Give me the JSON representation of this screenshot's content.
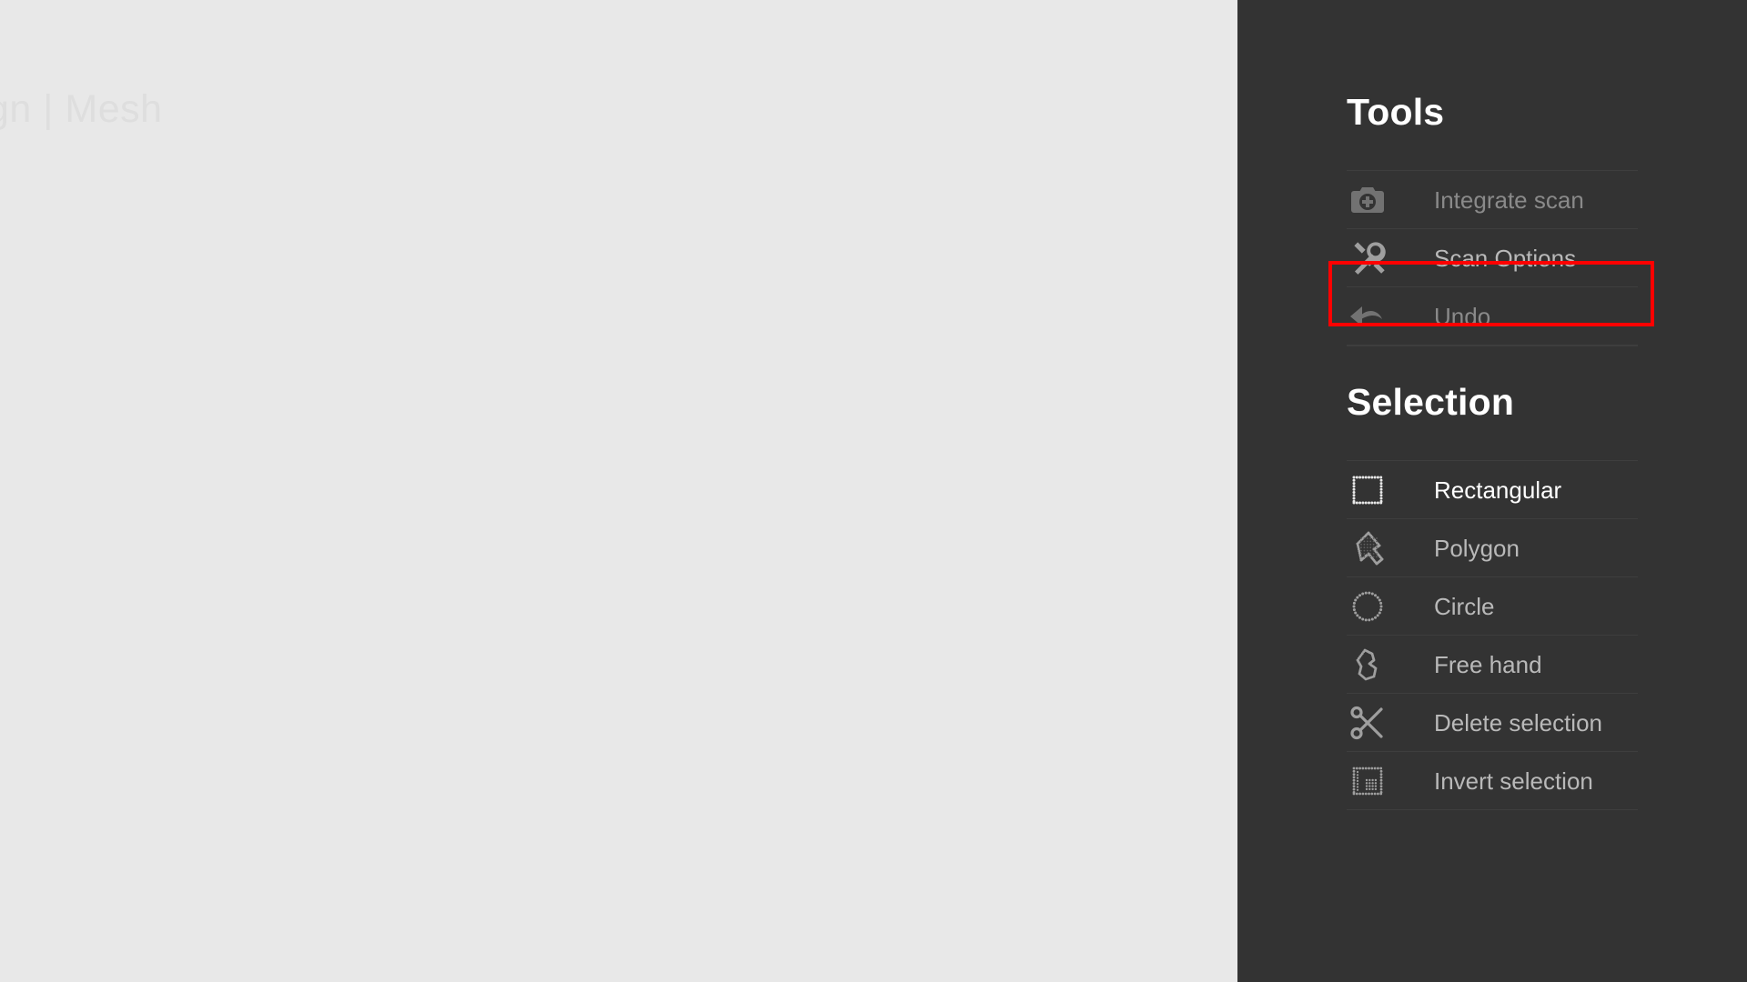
{
  "canvas": {
    "title_fragment": "gn | Mesh"
  },
  "sidebar": {
    "tools": {
      "heading": "Tools",
      "items": [
        {
          "label": "Integrate scan",
          "icon": "camera-plus-icon",
          "state": "dim"
        },
        {
          "label": "Scan Options",
          "icon": "wrench-hammer-icon",
          "state": "norm"
        },
        {
          "label": "Undo",
          "icon": "undo-arrow-icon",
          "state": "dim"
        }
      ]
    },
    "selection": {
      "heading": "Selection",
      "items": [
        {
          "label": "Rectangular",
          "icon": "dotted-rectangle-icon",
          "state": "active"
        },
        {
          "label": "Polygon",
          "icon": "dotted-polygon-icon",
          "state": "norm"
        },
        {
          "label": "Circle",
          "icon": "dotted-circle-icon",
          "state": "norm"
        },
        {
          "label": "Free hand",
          "icon": "dotted-freehand-icon",
          "state": "norm"
        },
        {
          "label": "Delete selection",
          "icon": "scissors-icon",
          "state": "norm"
        },
        {
          "label": "Invert selection",
          "icon": "invert-selection-icon",
          "state": "norm"
        }
      ]
    }
  },
  "annotation": {
    "highlight_target": "Scan Options",
    "highlight_color": "#ff0000"
  },
  "colors": {
    "canvas_bg": "#e8e8e8",
    "sidebar_bg": "#333333",
    "divider": "#3e3e3e",
    "label_dim": "#8a8a8a",
    "label_normal": "#b9b9b9",
    "label_active": "#ffffff",
    "heading": "#ffffff"
  }
}
